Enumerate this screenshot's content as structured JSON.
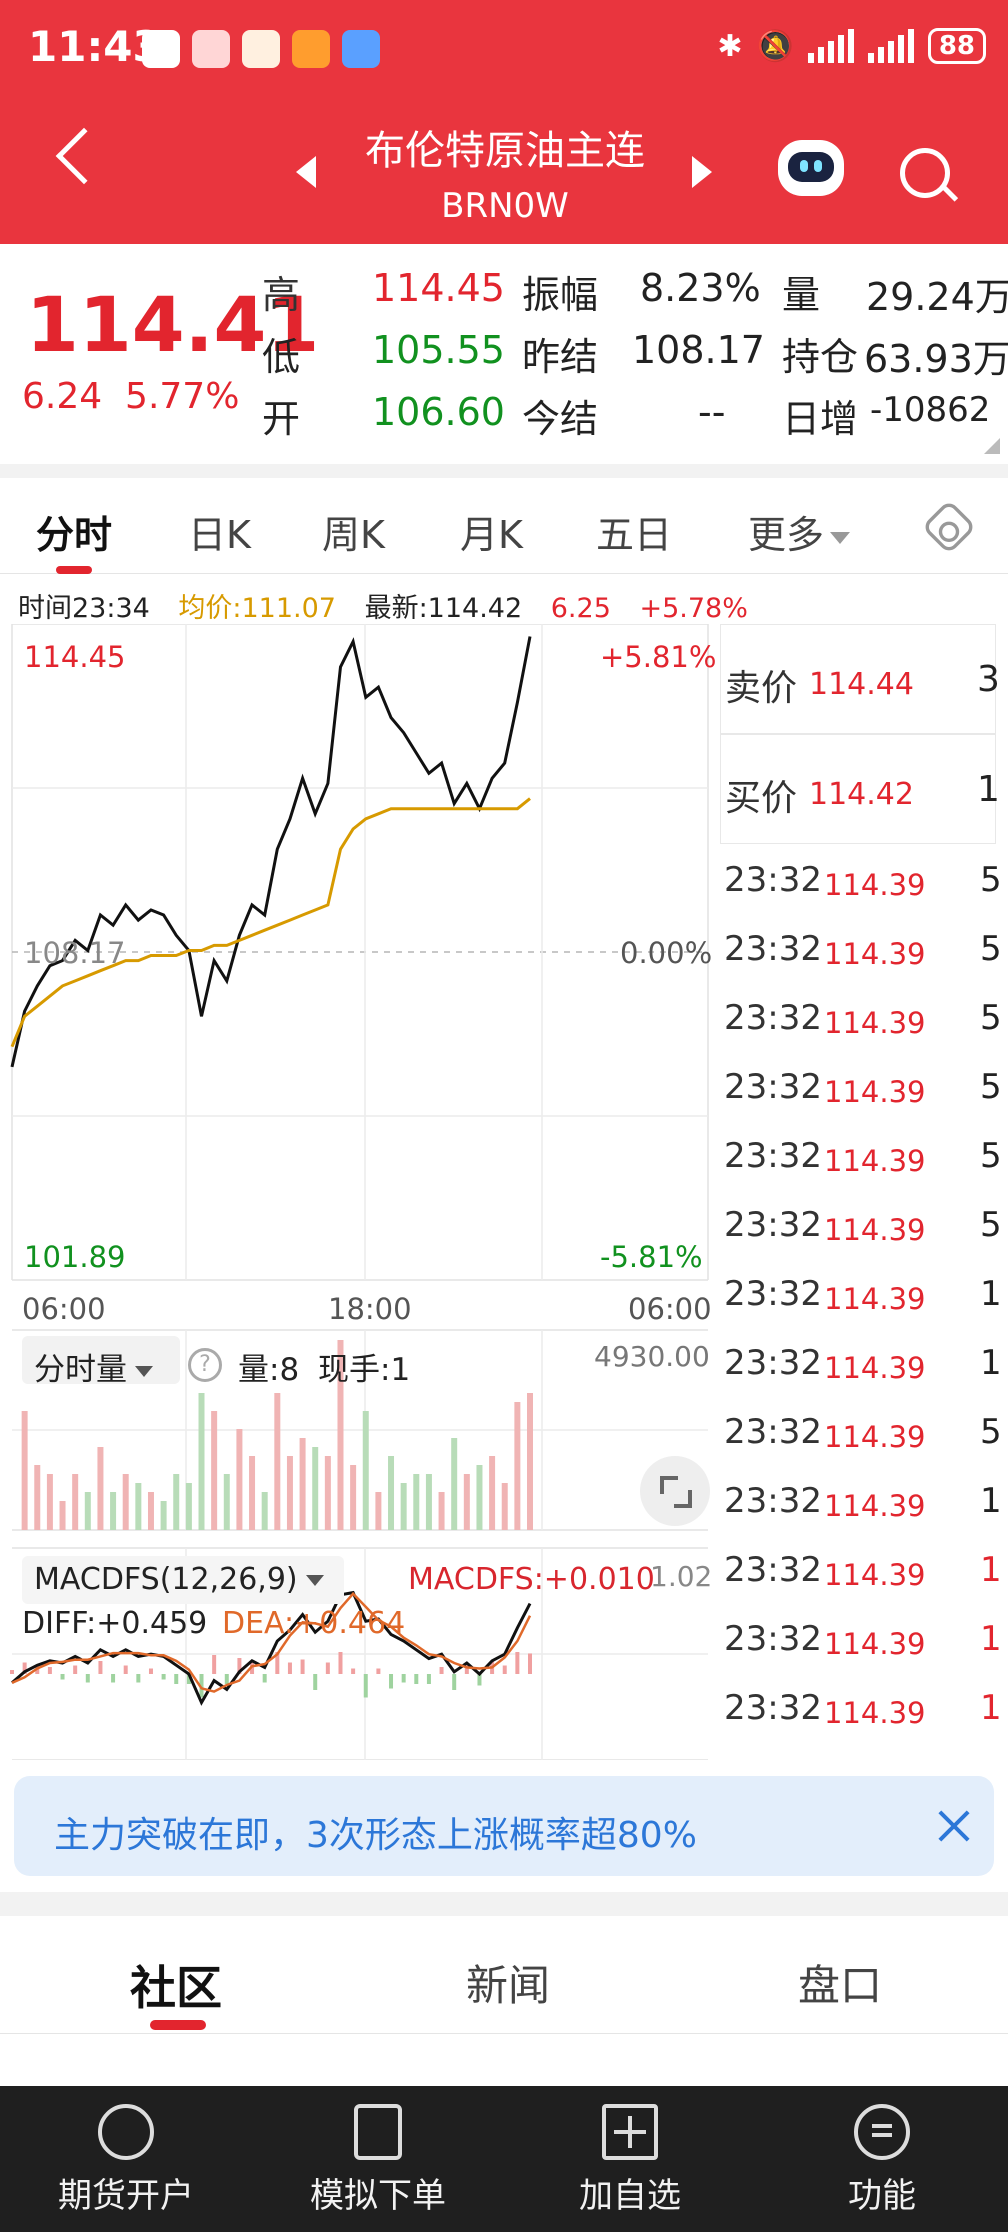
{
  "status": {
    "time": "11:43",
    "battery": "88"
  },
  "header": {
    "title": "布伦特原油主连",
    "subtitle": "BRN0W",
    "brand_color": "#e9353e"
  },
  "quote": {
    "price": "114.41",
    "change": "6.24",
    "change_pct": "5.77%",
    "high_label": "高",
    "high": "114.45",
    "low_label": "低",
    "low": "105.55",
    "open_label": "开",
    "open": "106.60",
    "amplitude_label": "振幅",
    "amplitude": "8.23%",
    "prev_settle_label": "昨结",
    "prev_settle": "108.17",
    "settle_label": "今结",
    "settle": "--",
    "volume_label": "量",
    "volume": "29.24万",
    "open_interest_label": "持仓",
    "open_interest": "63.93万",
    "daily_change_label": "日增",
    "daily_change": "-10862"
  },
  "tabs": {
    "intraday": "分时",
    "daily_k": "日K",
    "weekly_k": "周K",
    "monthly_k": "月K",
    "five_day": "五日",
    "more": "更多"
  },
  "info_line": {
    "time": "时间23:34",
    "avg": "均价:111.07",
    "latest": "最新:114.42",
    "chg": "6.25",
    "chg_pct": "+5.78%"
  },
  "chart_data": {
    "type": "line",
    "y_max_label": "114.45",
    "y_min_label": "101.89",
    "y_mid_label": "108.17",
    "pct_max_label": "+5.81%",
    "pct_mid_label": "0.00%",
    "pct_min_label": "-5.81%",
    "x_labels": [
      "06:00",
      "18:00",
      "06:00"
    ],
    "ylim": [
      101.89,
      114.45
    ],
    "grid": true,
    "series": [
      {
        "values": [
          105.9,
          107.0,
          107.5,
          107.9,
          108.0,
          108.4,
          108.2,
          108.9,
          108.7,
          109.1,
          108.8,
          109.0,
          108.9,
          108.5,
          108.2,
          106.9,
          108.0,
          107.6,
          108.5,
          109.1,
          108.9,
          110.2,
          110.8,
          111.6,
          110.9,
          111.5,
          113.8,
          114.3,
          113.2,
          113.4,
          112.8,
          112.5,
          112.1,
          111.7,
          111.9,
          111.1,
          111.5,
          111.0,
          111.6,
          111.9,
          113.1,
          114.4
        ],
        "color": "#111111"
      },
      {
        "values": [
          106.3,
          106.9,
          107.1,
          107.3,
          107.5,
          107.6,
          107.7,
          107.8,
          107.9,
          108.0,
          108.0,
          108.1,
          108.1,
          108.1,
          108.2,
          108.2,
          108.3,
          108.3,
          108.4,
          108.5,
          108.6,
          108.7,
          108.8,
          108.9,
          109.0,
          109.1,
          110.2,
          110.6,
          110.8,
          110.9,
          111.0,
          111.0,
          111.0,
          111.0,
          111.0,
          111.0,
          111.0,
          111.0,
          111.0,
          111.0,
          111.0,
          111.2
        ],
        "color": "#d79a00"
      }
    ]
  },
  "volume_panel": {
    "selector": "分时量",
    "help": "?",
    "vol": "量:8",
    "hand": "现手:1",
    "max": "4930.00"
  },
  "macd_panel": {
    "selector": "MACDFS(12,26,9)",
    "macdfs": "MACDFS:+0.010",
    "diff": "DIFF:+0.459",
    "dea": "DEA:+0.464",
    "max": "1.02"
  },
  "order_book": {
    "ask_label": "卖价",
    "ask_price": "114.44",
    "ask_qty": "3",
    "bid_label": "买价",
    "bid_price": "114.42",
    "bid_qty": "1",
    "ticks": [
      {
        "time": "23:32",
        "price": "114.39",
        "vol": "5",
        "up": false
      },
      {
        "time": "23:32",
        "price": "114.39",
        "vol": "5",
        "up": false
      },
      {
        "time": "23:32",
        "price": "114.39",
        "vol": "5",
        "up": false
      },
      {
        "time": "23:32",
        "price": "114.39",
        "vol": "5",
        "up": false
      },
      {
        "time": "23:32",
        "price": "114.39",
        "vol": "5",
        "up": false
      },
      {
        "time": "23:32",
        "price": "114.39",
        "vol": "5",
        "up": false
      },
      {
        "time": "23:32",
        "price": "114.39",
        "vol": "1",
        "up": false
      },
      {
        "time": "23:32",
        "price": "114.39",
        "vol": "1",
        "up": false
      },
      {
        "time": "23:32",
        "price": "114.39",
        "vol": "5",
        "up": false
      },
      {
        "time": "23:32",
        "price": "114.39",
        "vol": "1",
        "up": false
      },
      {
        "time": "23:32",
        "price": "114.39",
        "vol": "1",
        "up": true
      },
      {
        "time": "23:32",
        "price": "114.39",
        "vol": "1",
        "up": true
      },
      {
        "time": "23:32",
        "price": "114.39",
        "vol": "1",
        "up": true
      },
      {
        "time": "23:32",
        "price": "114.39",
        "vol": "1",
        "up": true
      }
    ]
  },
  "banner": {
    "text": "主力突破在即，3次形态上涨概率超80%"
  },
  "community_tabs": {
    "community": "社区",
    "news": "新闻",
    "book": "盘口"
  },
  "bottom_nav": {
    "account": "期货开户",
    "sim": "模拟下单",
    "watch": "加自选",
    "func": "功能"
  }
}
